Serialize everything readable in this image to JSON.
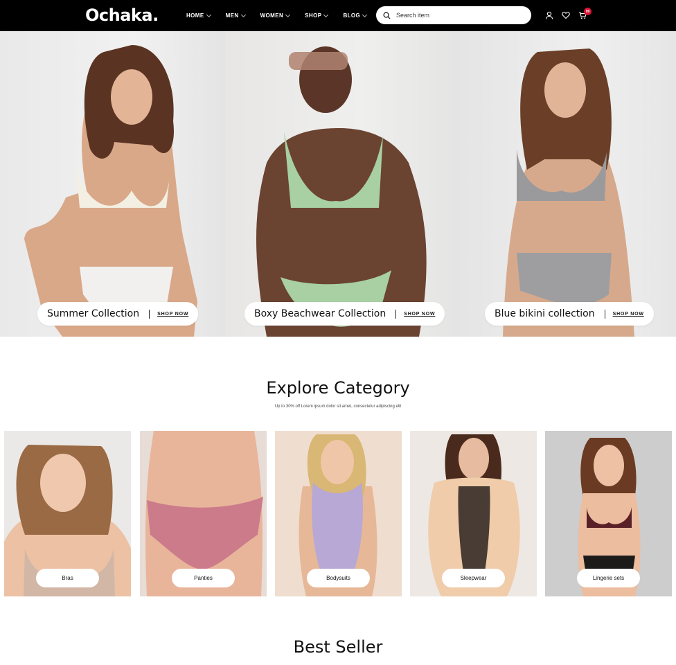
{
  "header": {
    "logo": "Ochaka.",
    "nav": [
      {
        "label": "HOME"
      },
      {
        "label": "MEN"
      },
      {
        "label": "WOMEN"
      },
      {
        "label": "SHOP"
      },
      {
        "label": "BLOG"
      }
    ],
    "search_placeholder": "Search item",
    "cart_count": "99",
    "icons": [
      "search-icon",
      "user-icon",
      "heart-icon",
      "cart-icon"
    ]
  },
  "hero": {
    "panels": [
      {
        "title": "Summer Collection",
        "cta": "SHOP NOW"
      },
      {
        "title": "Boxy Beachwear Collection",
        "cta": "SHOP NOW"
      },
      {
        "title": "Blue bikini collection",
        "cta": "SHOP NOW"
      }
    ]
  },
  "explore": {
    "title": "Explore Category",
    "subtitle": "Up to 30% off Lorem ipsum dolor sit amet, consectetur adipiscing elit",
    "categories": [
      {
        "label": "Bras"
      },
      {
        "label": "Panties"
      },
      {
        "label": "Bodysuits"
      },
      {
        "label": "Sleepwear"
      },
      {
        "label": "Lingerie sets"
      }
    ]
  },
  "best_seller": {
    "title": "Best Seller"
  },
  "colors": {
    "header_bg": "#000000",
    "badge": "#d6122f"
  }
}
